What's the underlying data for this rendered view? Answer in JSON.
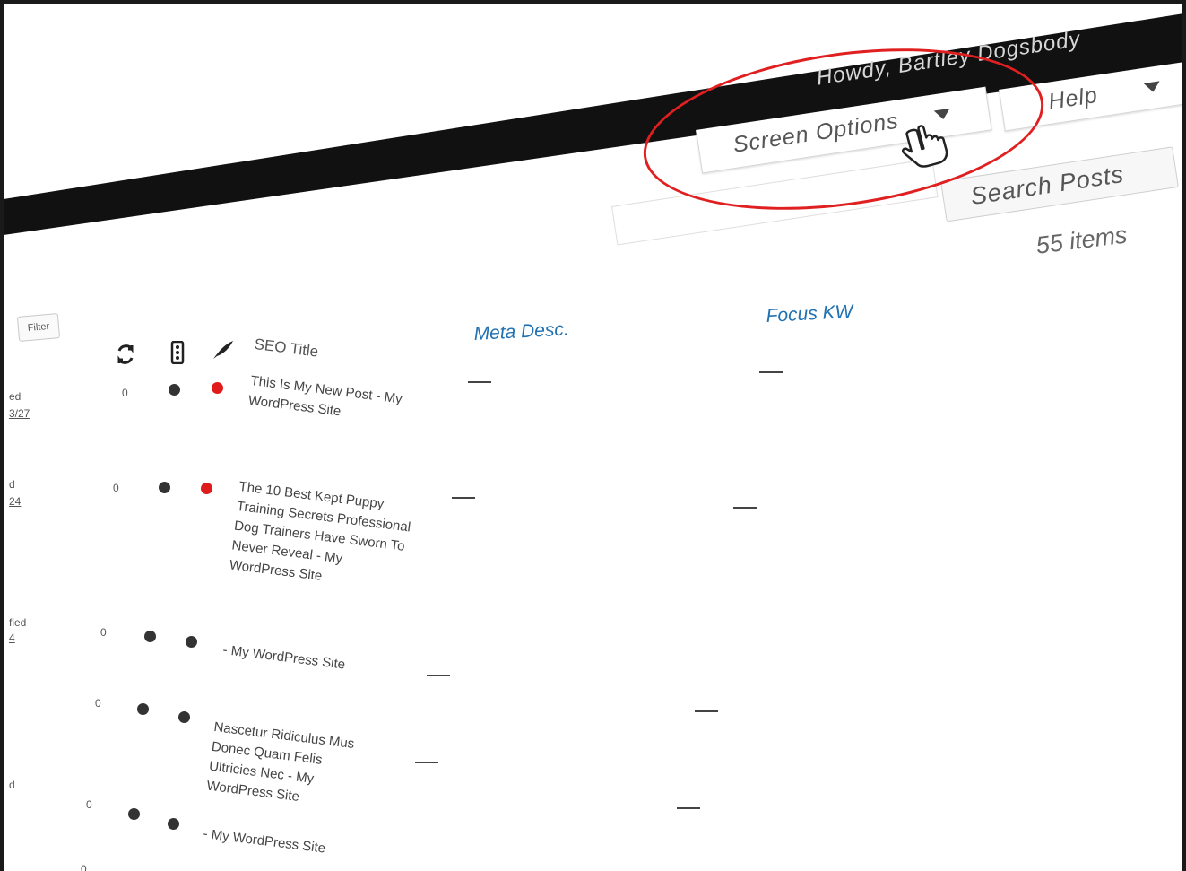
{
  "admin_bar": {
    "greeting": "Howdy, Bartley Dogsbody"
  },
  "screen_meta": {
    "screen_options_label": "Screen Options",
    "help_label": "Help"
  },
  "search": {
    "input_value": "",
    "button_label": "Search Posts"
  },
  "pagination": {
    "items_count": "55 items"
  },
  "filter": {
    "button_label": "Filter"
  },
  "columns": {
    "icon_1": "refresh-icon",
    "icon_2": "traffic-light-icon",
    "icon_3": "feather-icon",
    "seo_title": "SEO Title",
    "meta_desc": "Meta Desc.",
    "focus_kw": "Focus KW"
  },
  "rows": [
    {
      "count": "0",
      "dot1_color": "#333333",
      "dot2_color": "#e01b1b",
      "seo_title": "This Is My New Post - My WordPress Site",
      "meta_desc": "—",
      "focus_kw": "—",
      "frag_top": "ed",
      "frag_bottom": "3/27"
    },
    {
      "count": "0",
      "dot1_color": "#333333",
      "dot2_color": "#e01b1b",
      "seo_title": "The 10 Best Kept Puppy Training Secrets Professional Dog Trainers Have Sworn To Never Reveal - My WordPress Site",
      "meta_desc": "—",
      "focus_kw": "—",
      "frag_top": "d",
      "frag_bottom": "24"
    },
    {
      "count": "0",
      "dot1_color": "#333333",
      "dot2_color": "#333333",
      "seo_title": "- My WordPress Site",
      "meta_desc": "—",
      "focus_kw": "—",
      "frag_top": "fied",
      "frag_bottom": "4"
    },
    {
      "count": "0",
      "dot1_color": "#333333",
      "dot2_color": "#333333",
      "seo_title": "Nascetur Ridiculus Mus Donec Quam Felis Ultricies Nec - My WordPress Site",
      "meta_desc": "—",
      "focus_kw": "—",
      "frag_top": "d",
      "frag_bottom": ""
    },
    {
      "count": "0",
      "dot1_color": "#333333",
      "dot2_color": "#333333",
      "seo_title": "- My WordPress Site",
      "meta_desc": "—",
      "focus_kw": "—",
      "frag_top": "",
      "frag_bottom": ""
    },
    {
      "count": "0",
      "dot1_color": "",
      "dot2_color": "",
      "seo_title": "",
      "meta_desc": "",
      "focus_kw": "",
      "frag_top": "",
      "frag_bottom": ""
    }
  ],
  "annotation": {
    "color": "#e02020",
    "shape": "ellipse"
  },
  "cursor": {
    "type": "hand-pointer-icon"
  }
}
